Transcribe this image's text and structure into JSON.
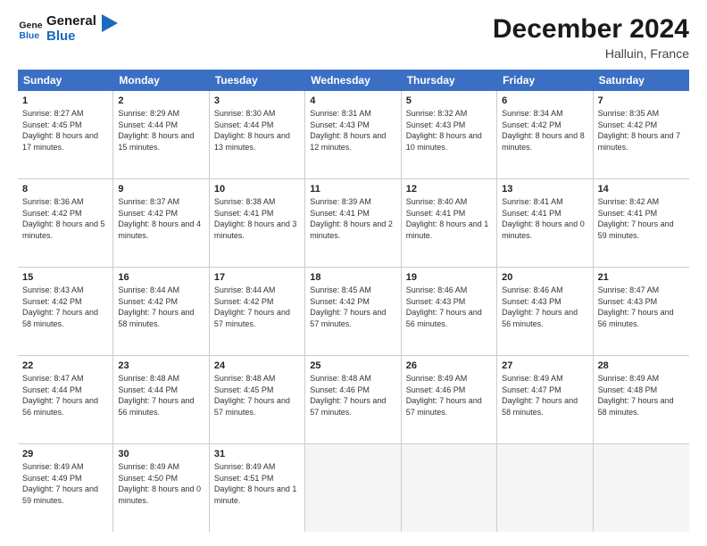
{
  "logo": {
    "line1": "General",
    "line2": "Blue"
  },
  "title": "December 2024",
  "location": "Halluin, France",
  "header_days": [
    "Sunday",
    "Monday",
    "Tuesday",
    "Wednesday",
    "Thursday",
    "Friday",
    "Saturday"
  ],
  "weeks": [
    [
      {
        "day": "1",
        "sunrise": "Sunrise: 8:27 AM",
        "sunset": "Sunset: 4:45 PM",
        "daylight": "Daylight: 8 hours and 17 minutes."
      },
      {
        "day": "2",
        "sunrise": "Sunrise: 8:29 AM",
        "sunset": "Sunset: 4:44 PM",
        "daylight": "Daylight: 8 hours and 15 minutes."
      },
      {
        "day": "3",
        "sunrise": "Sunrise: 8:30 AM",
        "sunset": "Sunset: 4:44 PM",
        "daylight": "Daylight: 8 hours and 13 minutes."
      },
      {
        "day": "4",
        "sunrise": "Sunrise: 8:31 AM",
        "sunset": "Sunset: 4:43 PM",
        "daylight": "Daylight: 8 hours and 12 minutes."
      },
      {
        "day": "5",
        "sunrise": "Sunrise: 8:32 AM",
        "sunset": "Sunset: 4:43 PM",
        "daylight": "Daylight: 8 hours and 10 minutes."
      },
      {
        "day": "6",
        "sunrise": "Sunrise: 8:34 AM",
        "sunset": "Sunset: 4:42 PM",
        "daylight": "Daylight: 8 hours and 8 minutes."
      },
      {
        "day": "7",
        "sunrise": "Sunrise: 8:35 AM",
        "sunset": "Sunset: 4:42 PM",
        "daylight": "Daylight: 8 hours and 7 minutes."
      }
    ],
    [
      {
        "day": "8",
        "sunrise": "Sunrise: 8:36 AM",
        "sunset": "Sunset: 4:42 PM",
        "daylight": "Daylight: 8 hours and 5 minutes."
      },
      {
        "day": "9",
        "sunrise": "Sunrise: 8:37 AM",
        "sunset": "Sunset: 4:42 PM",
        "daylight": "Daylight: 8 hours and 4 minutes."
      },
      {
        "day": "10",
        "sunrise": "Sunrise: 8:38 AM",
        "sunset": "Sunset: 4:41 PM",
        "daylight": "Daylight: 8 hours and 3 minutes."
      },
      {
        "day": "11",
        "sunrise": "Sunrise: 8:39 AM",
        "sunset": "Sunset: 4:41 PM",
        "daylight": "Daylight: 8 hours and 2 minutes."
      },
      {
        "day": "12",
        "sunrise": "Sunrise: 8:40 AM",
        "sunset": "Sunset: 4:41 PM",
        "daylight": "Daylight: 8 hours and 1 minute."
      },
      {
        "day": "13",
        "sunrise": "Sunrise: 8:41 AM",
        "sunset": "Sunset: 4:41 PM",
        "daylight": "Daylight: 8 hours and 0 minutes."
      },
      {
        "day": "14",
        "sunrise": "Sunrise: 8:42 AM",
        "sunset": "Sunset: 4:41 PM",
        "daylight": "Daylight: 7 hours and 59 minutes."
      }
    ],
    [
      {
        "day": "15",
        "sunrise": "Sunrise: 8:43 AM",
        "sunset": "Sunset: 4:42 PM",
        "daylight": "Daylight: 7 hours and 58 minutes."
      },
      {
        "day": "16",
        "sunrise": "Sunrise: 8:44 AM",
        "sunset": "Sunset: 4:42 PM",
        "daylight": "Daylight: 7 hours and 58 minutes."
      },
      {
        "day": "17",
        "sunrise": "Sunrise: 8:44 AM",
        "sunset": "Sunset: 4:42 PM",
        "daylight": "Daylight: 7 hours and 57 minutes."
      },
      {
        "day": "18",
        "sunrise": "Sunrise: 8:45 AM",
        "sunset": "Sunset: 4:42 PM",
        "daylight": "Daylight: 7 hours and 57 minutes."
      },
      {
        "day": "19",
        "sunrise": "Sunrise: 8:46 AM",
        "sunset": "Sunset: 4:43 PM",
        "daylight": "Daylight: 7 hours and 56 minutes."
      },
      {
        "day": "20",
        "sunrise": "Sunrise: 8:46 AM",
        "sunset": "Sunset: 4:43 PM",
        "daylight": "Daylight: 7 hours and 56 minutes."
      },
      {
        "day": "21",
        "sunrise": "Sunrise: 8:47 AM",
        "sunset": "Sunset: 4:43 PM",
        "daylight": "Daylight: 7 hours and 56 minutes."
      }
    ],
    [
      {
        "day": "22",
        "sunrise": "Sunrise: 8:47 AM",
        "sunset": "Sunset: 4:44 PM",
        "daylight": "Daylight: 7 hours and 56 minutes."
      },
      {
        "day": "23",
        "sunrise": "Sunrise: 8:48 AM",
        "sunset": "Sunset: 4:44 PM",
        "daylight": "Daylight: 7 hours and 56 minutes."
      },
      {
        "day": "24",
        "sunrise": "Sunrise: 8:48 AM",
        "sunset": "Sunset: 4:45 PM",
        "daylight": "Daylight: 7 hours and 57 minutes."
      },
      {
        "day": "25",
        "sunrise": "Sunrise: 8:48 AM",
        "sunset": "Sunset: 4:46 PM",
        "daylight": "Daylight: 7 hours and 57 minutes."
      },
      {
        "day": "26",
        "sunrise": "Sunrise: 8:49 AM",
        "sunset": "Sunset: 4:46 PM",
        "daylight": "Daylight: 7 hours and 57 minutes."
      },
      {
        "day": "27",
        "sunrise": "Sunrise: 8:49 AM",
        "sunset": "Sunset: 4:47 PM",
        "daylight": "Daylight: 7 hours and 58 minutes."
      },
      {
        "day": "28",
        "sunrise": "Sunrise: 8:49 AM",
        "sunset": "Sunset: 4:48 PM",
        "daylight": "Daylight: 7 hours and 58 minutes."
      }
    ],
    [
      {
        "day": "29",
        "sunrise": "Sunrise: 8:49 AM",
        "sunset": "Sunset: 4:49 PM",
        "daylight": "Daylight: 7 hours and 59 minutes."
      },
      {
        "day": "30",
        "sunrise": "Sunrise: 8:49 AM",
        "sunset": "Sunset: 4:50 PM",
        "daylight": "Daylight: 8 hours and 0 minutes."
      },
      {
        "day": "31",
        "sunrise": "Sunrise: 8:49 AM",
        "sunset": "Sunset: 4:51 PM",
        "daylight": "Daylight: 8 hours and 1 minute."
      },
      {
        "day": "",
        "sunrise": "",
        "sunset": "",
        "daylight": ""
      },
      {
        "day": "",
        "sunrise": "",
        "sunset": "",
        "daylight": ""
      },
      {
        "day": "",
        "sunrise": "",
        "sunset": "",
        "daylight": ""
      },
      {
        "day": "",
        "sunrise": "",
        "sunset": "",
        "daylight": ""
      }
    ]
  ]
}
